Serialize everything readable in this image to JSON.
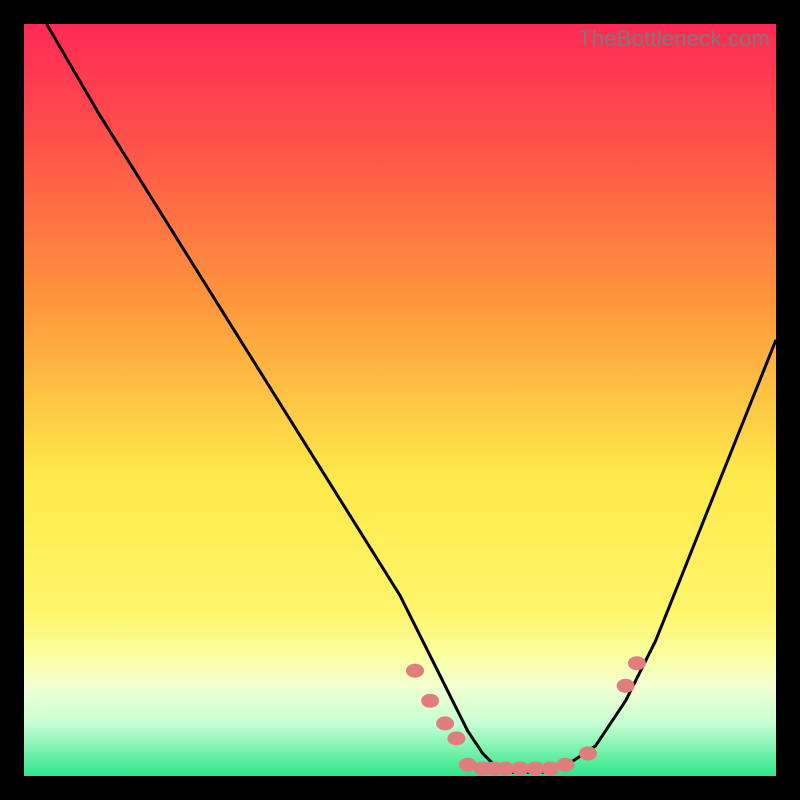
{
  "watermark": "TheBottleneck.com",
  "colors": {
    "black": "#000000",
    "curve": "#000000",
    "marker_fill": "#e27d7d",
    "marker_stroke": "#c66",
    "grad_top": "#ff2a55",
    "grad_mid1": "#ff8a3c",
    "grad_mid2": "#ffe94a",
    "grad_band": "#f9ff9f",
    "grad_bottom": "#2ee58a"
  },
  "chart_data": {
    "type": "line",
    "title": "",
    "xlabel": "",
    "ylabel": "",
    "xlim": [
      0,
      100
    ],
    "ylim": [
      0,
      100
    ],
    "x": [
      3,
      10,
      20,
      30,
      40,
      50,
      55,
      57,
      59,
      61,
      63,
      65,
      67,
      69,
      71,
      73,
      76,
      80,
      84,
      88,
      92,
      96,
      100
    ],
    "values": [
      100,
      88,
      72,
      56,
      40,
      24,
      14,
      10,
      6,
      3,
      1,
      0.5,
      0.5,
      0.5,
      1,
      2,
      4,
      10,
      18,
      28,
      38,
      48,
      58
    ],
    "markers": [
      {
        "x": 52,
        "y": 14
      },
      {
        "x": 54,
        "y": 10
      },
      {
        "x": 56,
        "y": 7
      },
      {
        "x": 57.5,
        "y": 5
      },
      {
        "x": 59,
        "y": 1.5
      },
      {
        "x": 61,
        "y": 1
      },
      {
        "x": 62.5,
        "y": 1
      },
      {
        "x": 64,
        "y": 1
      },
      {
        "x": 66,
        "y": 1
      },
      {
        "x": 68,
        "y": 1
      },
      {
        "x": 70,
        "y": 1
      },
      {
        "x": 72,
        "y": 1.5
      },
      {
        "x": 75,
        "y": 3
      },
      {
        "x": 80,
        "y": 12
      },
      {
        "x": 81.5,
        "y": 15
      }
    ]
  }
}
